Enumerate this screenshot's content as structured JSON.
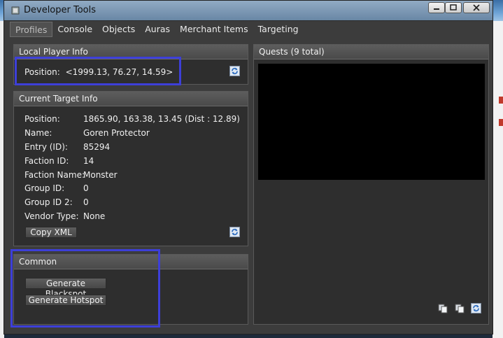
{
  "window": {
    "title": "Developer Tools"
  },
  "tabs": [
    "Profiles",
    "Console",
    "Objects",
    "Auras",
    "Merchant Items",
    "Targeting"
  ],
  "local_player": {
    "header": "Local Player Info",
    "position_label": "Position:",
    "position_value": "<1999.13, 76.27, 14.59>"
  },
  "current_target": {
    "header": "Current Target Info",
    "rows": [
      {
        "label": "Position:",
        "value": "1865.90, 163.38, 13.45 (Dist : 12.89)"
      },
      {
        "label": "Name:",
        "value": "Goren Protector"
      },
      {
        "label": "Entry (ID):",
        "value": "85294"
      },
      {
        "label": "Faction ID:",
        "value": "14"
      },
      {
        "label": "Faction Name:",
        "value": "Monster"
      },
      {
        "label": "Group ID:",
        "value": "0"
      },
      {
        "label": "Group ID 2:",
        "value": "0"
      },
      {
        "label": "Vendor Type:",
        "value": "None"
      }
    ],
    "copy_button": "Copy XML"
  },
  "common": {
    "header": "Common",
    "buttons": [
      "Generate Blackspot",
      "Generate Hotspot"
    ]
  },
  "quests": {
    "header": "Quests (9 total)"
  },
  "colors": {
    "highlight": "#3d3fd8",
    "panel": "#2e2e2e",
    "window": "#3c3c3c"
  }
}
